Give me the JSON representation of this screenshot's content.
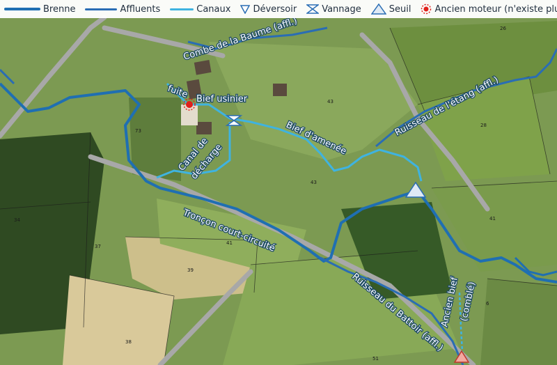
{
  "legend": {
    "brenne": "Brenne",
    "affluents": "Affluents",
    "canaux": "Canaux",
    "deversoir": "Déversoir",
    "vannage": "Vannage",
    "seuil": "Seuil",
    "ancien_moteur": "Ancien moteur (n'existe plus)"
  },
  "colors": {
    "brenne": "#1f6fb2",
    "affluents": "#2a6db4",
    "canaux": "#3fb3e0",
    "moteur": "#e0201c"
  },
  "labels": {
    "combe": "Combe de la Baume (affl.)",
    "fuite": "fuite",
    "bief_usinier": "Bief usinier",
    "bief_amenee": "Bief d'amenée",
    "ruisseau_etang": "Ruisseau de l'étang (affl.)",
    "canal_decharge_1": "Canal de",
    "canal_decharge_2": "décharge",
    "troncon": "Tronçon court-circuité",
    "battoir": "Ruisseau du Battoir (affl.)",
    "ancien_bief_1": "Ancien bief",
    "ancien_bief_2": "(comblé)"
  },
  "parcels": {
    "p26": "26",
    "p43a": "43",
    "p28": "28",
    "p73": "73",
    "p43b": "43",
    "p34": "34",
    "p37": "37",
    "p41a": "41",
    "p41b": "41",
    "p39": "39",
    "p38": "38",
    "p6": "6",
    "p51": "51"
  }
}
